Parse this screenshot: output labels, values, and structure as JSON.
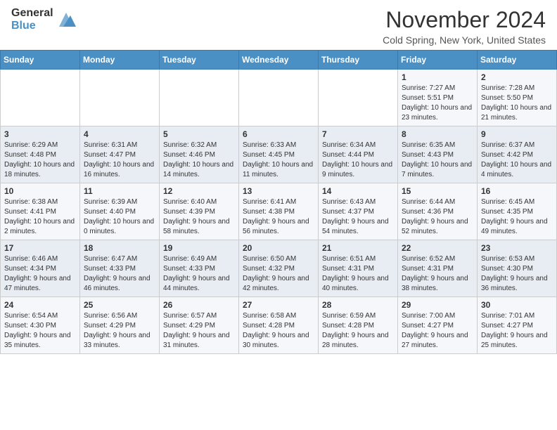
{
  "logo": {
    "general": "General",
    "blue": "Blue"
  },
  "header": {
    "month": "November 2024",
    "location": "Cold Spring, New York, United States"
  },
  "weekdays": [
    "Sunday",
    "Monday",
    "Tuesday",
    "Wednesday",
    "Thursday",
    "Friday",
    "Saturday"
  ],
  "weeks": [
    [
      {
        "day": "",
        "info": ""
      },
      {
        "day": "",
        "info": ""
      },
      {
        "day": "",
        "info": ""
      },
      {
        "day": "",
        "info": ""
      },
      {
        "day": "",
        "info": ""
      },
      {
        "day": "1",
        "info": "Sunrise: 7:27 AM\nSunset: 5:51 PM\nDaylight: 10 hours and 23 minutes."
      },
      {
        "day": "2",
        "info": "Sunrise: 7:28 AM\nSunset: 5:50 PM\nDaylight: 10 hours and 21 minutes."
      }
    ],
    [
      {
        "day": "3",
        "info": "Sunrise: 6:29 AM\nSunset: 4:48 PM\nDaylight: 10 hours and 18 minutes."
      },
      {
        "day": "4",
        "info": "Sunrise: 6:31 AM\nSunset: 4:47 PM\nDaylight: 10 hours and 16 minutes."
      },
      {
        "day": "5",
        "info": "Sunrise: 6:32 AM\nSunset: 4:46 PM\nDaylight: 10 hours and 14 minutes."
      },
      {
        "day": "6",
        "info": "Sunrise: 6:33 AM\nSunset: 4:45 PM\nDaylight: 10 hours and 11 minutes."
      },
      {
        "day": "7",
        "info": "Sunrise: 6:34 AM\nSunset: 4:44 PM\nDaylight: 10 hours and 9 minutes."
      },
      {
        "day": "8",
        "info": "Sunrise: 6:35 AM\nSunset: 4:43 PM\nDaylight: 10 hours and 7 minutes."
      },
      {
        "day": "9",
        "info": "Sunrise: 6:37 AM\nSunset: 4:42 PM\nDaylight: 10 hours and 4 minutes."
      }
    ],
    [
      {
        "day": "10",
        "info": "Sunrise: 6:38 AM\nSunset: 4:41 PM\nDaylight: 10 hours and 2 minutes."
      },
      {
        "day": "11",
        "info": "Sunrise: 6:39 AM\nSunset: 4:40 PM\nDaylight: 10 hours and 0 minutes."
      },
      {
        "day": "12",
        "info": "Sunrise: 6:40 AM\nSunset: 4:39 PM\nDaylight: 9 hours and 58 minutes."
      },
      {
        "day": "13",
        "info": "Sunrise: 6:41 AM\nSunset: 4:38 PM\nDaylight: 9 hours and 56 minutes."
      },
      {
        "day": "14",
        "info": "Sunrise: 6:43 AM\nSunset: 4:37 PM\nDaylight: 9 hours and 54 minutes."
      },
      {
        "day": "15",
        "info": "Sunrise: 6:44 AM\nSunset: 4:36 PM\nDaylight: 9 hours and 52 minutes."
      },
      {
        "day": "16",
        "info": "Sunrise: 6:45 AM\nSunset: 4:35 PM\nDaylight: 9 hours and 49 minutes."
      }
    ],
    [
      {
        "day": "17",
        "info": "Sunrise: 6:46 AM\nSunset: 4:34 PM\nDaylight: 9 hours and 47 minutes."
      },
      {
        "day": "18",
        "info": "Sunrise: 6:47 AM\nSunset: 4:33 PM\nDaylight: 9 hours and 46 minutes."
      },
      {
        "day": "19",
        "info": "Sunrise: 6:49 AM\nSunset: 4:33 PM\nDaylight: 9 hours and 44 minutes."
      },
      {
        "day": "20",
        "info": "Sunrise: 6:50 AM\nSunset: 4:32 PM\nDaylight: 9 hours and 42 minutes."
      },
      {
        "day": "21",
        "info": "Sunrise: 6:51 AM\nSunset: 4:31 PM\nDaylight: 9 hours and 40 minutes."
      },
      {
        "day": "22",
        "info": "Sunrise: 6:52 AM\nSunset: 4:31 PM\nDaylight: 9 hours and 38 minutes."
      },
      {
        "day": "23",
        "info": "Sunrise: 6:53 AM\nSunset: 4:30 PM\nDaylight: 9 hours and 36 minutes."
      }
    ],
    [
      {
        "day": "24",
        "info": "Sunrise: 6:54 AM\nSunset: 4:30 PM\nDaylight: 9 hours and 35 minutes."
      },
      {
        "day": "25",
        "info": "Sunrise: 6:56 AM\nSunset: 4:29 PM\nDaylight: 9 hours and 33 minutes."
      },
      {
        "day": "26",
        "info": "Sunrise: 6:57 AM\nSunset: 4:29 PM\nDaylight: 9 hours and 31 minutes."
      },
      {
        "day": "27",
        "info": "Sunrise: 6:58 AM\nSunset: 4:28 PM\nDaylight: 9 hours and 30 minutes."
      },
      {
        "day": "28",
        "info": "Sunrise: 6:59 AM\nSunset: 4:28 PM\nDaylight: 9 hours and 28 minutes."
      },
      {
        "day": "29",
        "info": "Sunrise: 7:00 AM\nSunset: 4:27 PM\nDaylight: 9 hours and 27 minutes."
      },
      {
        "day": "30",
        "info": "Sunrise: 7:01 AM\nSunset: 4:27 PM\nDaylight: 9 hours and 25 minutes."
      }
    ]
  ]
}
